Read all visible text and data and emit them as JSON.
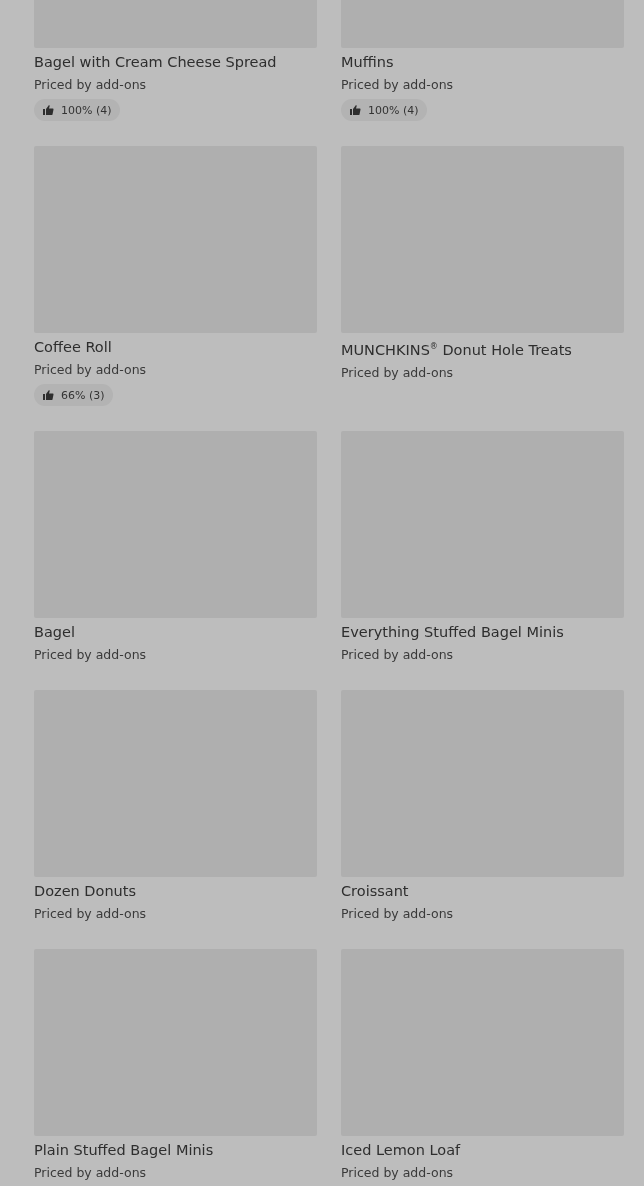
{
  "items": [
    {
      "name": "Bagel with Cream Cheese Spread",
      "price": "Priced by add-ons",
      "rating": "100% (4)"
    },
    {
      "name": "Muffins",
      "price": "Priced by add-ons",
      "rating": "100% (4)"
    },
    {
      "name": "Coffee Roll",
      "price": "Priced by add-ons",
      "rating": "66% (3)"
    },
    {
      "name": "MUNCHKINS$^{®}$ Donut Hole Treats",
      "price": "Priced by add-ons"
    },
    {
      "name": "Bagel",
      "price": "Priced by add-ons"
    },
    {
      "name": "Everything Stuffed Bagel Minis",
      "price": "Priced by add-ons"
    },
    {
      "name": "Dozen Donuts",
      "price": "Priced by add-ons"
    },
    {
      "name": "Croissant",
      "price": "Priced by add-ons"
    },
    {
      "name": "Plain Stuffed Bagel Minis",
      "price": "Priced by add-ons"
    },
    {
      "name": "Iced Lemon Loaf",
      "price": "Priced by add-ons"
    }
  ]
}
